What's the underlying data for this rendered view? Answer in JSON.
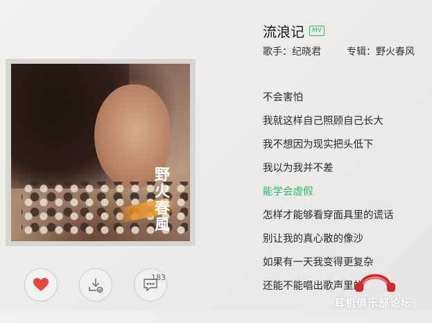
{
  "song": {
    "title": "流浪记",
    "mv_badge": "MV",
    "artist_label": "歌手：纪晓君",
    "album_label": "专辑：野火春风"
  },
  "cover": {
    "vertical_title": "野火春風"
  },
  "actions": {
    "like_icon": "heart-icon",
    "download_icon": "download-icon",
    "comment_icon": "comment-icon",
    "comment_count": "183",
    "like_color": "#e8453c"
  },
  "lyrics": [
    {
      "text": "不会害怕",
      "state": "normal"
    },
    {
      "text": "我就这样自己照顾自己长大",
      "state": "normal"
    },
    {
      "text": "我不想因为现实把头低下",
      "state": "normal"
    },
    {
      "text": "我以为我并不差",
      "state": "normal"
    },
    {
      "text": "能学会虚假",
      "state": "active"
    },
    {
      "text": "怎样才能够看穿面具里的谎话",
      "state": "normal"
    },
    {
      "text": "别让我的真心散的像沙",
      "state": "normal"
    },
    {
      "text": "如果有一天我变得更复杂",
      "state": "normal"
    },
    {
      "text": "还能不能唱出歌声里的",
      "state": "normal"
    },
    {
      "text": "",
      "state": "faded"
    }
  ],
  "watermark": {
    "text": "耳机俱乐部论坛"
  },
  "colors": {
    "accent": "#2ebd6e",
    "like": "#e8453c",
    "watermark_red": "#d7262c"
  }
}
